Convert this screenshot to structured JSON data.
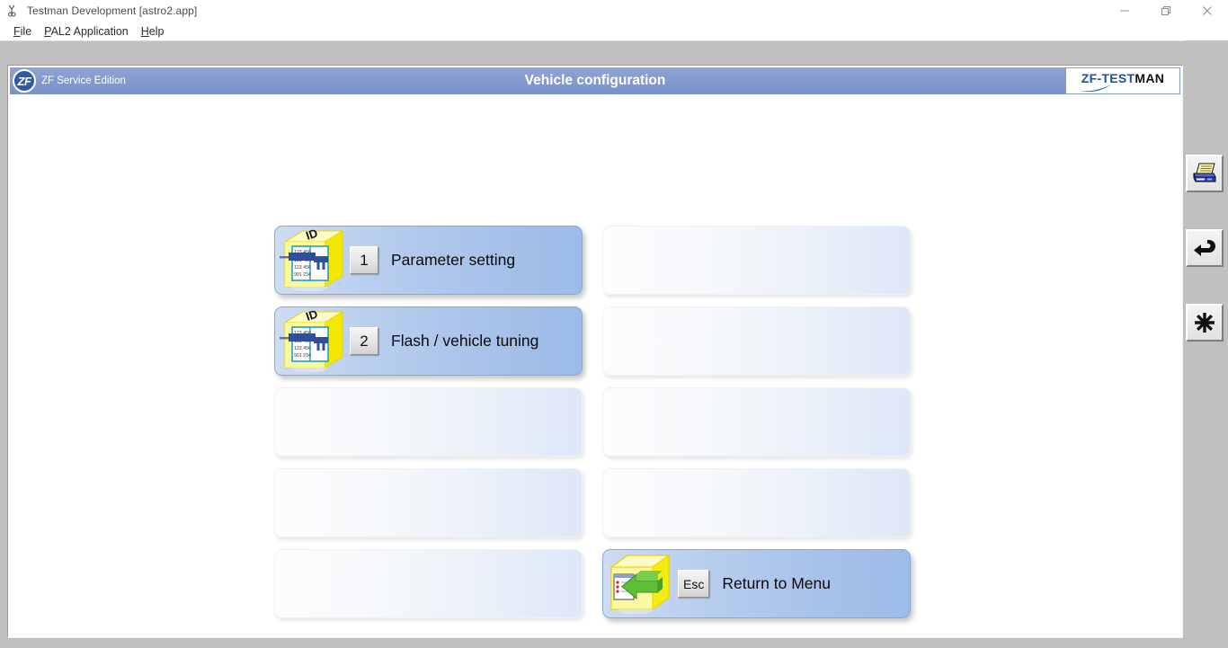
{
  "window": {
    "title": "Testman Development [astro2.app]",
    "icon": "app-icon",
    "controls": [
      {
        "name": "minimize",
        "glyph": "minimize-icon"
      },
      {
        "name": "maximize",
        "glyph": "restore-icon"
      },
      {
        "name": "close",
        "glyph": "close-icon"
      }
    ]
  },
  "menubar": {
    "items": [
      {
        "accel": "F",
        "rest": "ile"
      },
      {
        "accel": "P",
        "rest": "AL2 Application"
      },
      {
        "accel": "H",
        "rest": "elp"
      }
    ]
  },
  "header": {
    "badge": "ZF",
    "subtitle": "ZF Service Edition",
    "title": "Vehicle configuration",
    "logo": {
      "part_blue": "ZF-TEST",
      "part_black": "MAN",
      "blue": "#1b4f9c",
      "black": "#111111"
    },
    "bg_color": "#8299ce"
  },
  "menu_grid": {
    "rows": [
      [
        {
          "key": "1",
          "label": "Parameter setting",
          "icon": "parameter-box-icon",
          "state": "active"
        },
        {
          "key": "",
          "label": "",
          "icon": "",
          "state": "empty"
        }
      ],
      [
        {
          "key": "2",
          "label": "Flash / vehicle tuning",
          "icon": "parameter-box-icon",
          "state": "active"
        },
        {
          "key": "",
          "label": "",
          "icon": "",
          "state": "empty"
        }
      ],
      [
        {
          "key": "",
          "label": "",
          "icon": "",
          "state": "empty"
        },
        {
          "key": "",
          "label": "",
          "icon": "",
          "state": "empty"
        }
      ],
      [
        {
          "key": "",
          "label": "",
          "icon": "",
          "state": "empty"
        },
        {
          "key": "",
          "label": "",
          "icon": "",
          "state": "empty"
        }
      ],
      [
        {
          "key": "",
          "label": "",
          "icon": "",
          "state": "empty"
        },
        {
          "key": "Esc",
          "label": "Return to Menu",
          "icon": "return-arrow-box-icon",
          "state": "active"
        }
      ]
    ]
  },
  "toolbar": {
    "buttons": [
      {
        "name": "print-button",
        "icon": "printer-icon"
      },
      {
        "name": "back-button",
        "icon": "undo-arrow-icon"
      },
      {
        "name": "options-button",
        "icon": "asterisk-icon"
      }
    ]
  },
  "colors": {
    "window_chrome": "#c0c0c0",
    "panel": "#ffffff",
    "header_blue": "#8299ce",
    "active_button": "#a9c3ea",
    "icon_yellow": "#f5f000",
    "icon_green": "#5dbb3a",
    "icon_blue": "#1c3f8f"
  }
}
